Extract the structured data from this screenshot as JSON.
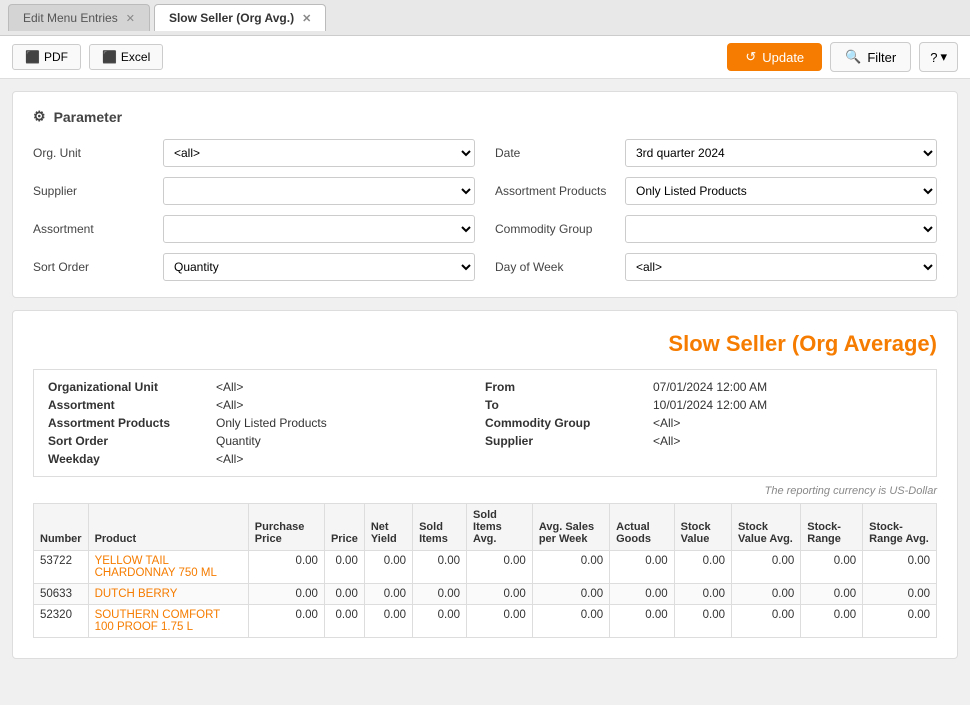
{
  "tabs": [
    {
      "label": "Edit Menu Entries",
      "active": false,
      "closable": true
    },
    {
      "label": "Slow Seller (Org Avg.)",
      "active": true,
      "closable": true
    }
  ],
  "toolbar": {
    "pdf_label": "PDF",
    "excel_label": "Excel",
    "update_label": "Update",
    "filter_label": "Filter",
    "help_label": "?"
  },
  "parameter": {
    "title": "Parameter",
    "fields": {
      "org_unit": {
        "label": "Org. Unit",
        "value": "<all>",
        "options": [
          "<all>"
        ]
      },
      "date": {
        "label": "Date",
        "value": "3rd quarter 2024",
        "options": [
          "3rd quarter 2024"
        ]
      },
      "supplier": {
        "label": "Supplier",
        "value": "",
        "options": []
      },
      "assortment_products": {
        "label": "Assortment Products",
        "value": "Only Listed Products",
        "options": [
          "Only Listed Products"
        ]
      },
      "assortment": {
        "label": "Assortment",
        "value": "",
        "options": []
      },
      "commodity_group": {
        "label": "Commodity Group",
        "value": "",
        "options": []
      },
      "sort_order": {
        "label": "Sort Order",
        "value": "Quantity",
        "options": [
          "Quantity"
        ]
      },
      "day_of_week": {
        "label": "Day of Week",
        "value": "<all>",
        "options": [
          "<all>"
        ]
      }
    }
  },
  "report": {
    "title": "Slow Seller (Org Average)",
    "meta": {
      "org_unit_label": "Organizational Unit",
      "org_unit_val": "<All>",
      "from_label": "From",
      "from_val": "07/01/2024 12:00 AM",
      "assortment_label": "Assortment",
      "assortment_val": "<All>",
      "to_label": "To",
      "to_val": "10/01/2024 12:00 AM",
      "assortment_products_label": "Assortment Products",
      "assortment_products_val": "Only Listed Products",
      "commodity_group_label": "Commodity Group",
      "commodity_group_val": "<All>",
      "sort_order_label": "Sort Order",
      "sort_order_val": "Quantity",
      "supplier_label": "Supplier",
      "supplier_val": "<All>",
      "weekday_label": "Weekday",
      "weekday_val": "<All>"
    },
    "currency_note": "The reporting currency is US-Dollar",
    "columns": [
      "Number",
      "Product",
      "Purchase Price",
      "Price",
      "Net Yield",
      "Sold Items",
      "Sold Items Avg.",
      "Avg. Sales per Week",
      "Actual Goods",
      "Stock Value",
      "Stock Value Avg.",
      "Stock-Range",
      "Stock-Range Avg."
    ],
    "rows": [
      {
        "number": "53722",
        "product": "YELLOW TAIL CHARDONNAY 750 ML",
        "purchase_price": "0.00",
        "price": "0.00",
        "net_yield": "0.00",
        "sold_items": "0.00",
        "sold_items_avg": "0.00",
        "avg_sales_per_week": "0.00",
        "actual_goods": "0.00",
        "stock_value": "0.00",
        "stock_value_avg": "0.00",
        "stock_range": "0.00",
        "stock_range_avg": "0.00"
      },
      {
        "number": "50633",
        "product": "DUTCH BERRY",
        "purchase_price": "0.00",
        "price": "0.00",
        "net_yield": "0.00",
        "sold_items": "0.00",
        "sold_items_avg": "0.00",
        "avg_sales_per_week": "0.00",
        "actual_goods": "0.00",
        "stock_value": "0.00",
        "stock_value_avg": "0.00",
        "stock_range": "0.00",
        "stock_range_avg": "0.00"
      },
      {
        "number": "52320",
        "product": "SOUTHERN COMFORT 100 PROOF 1.75 L",
        "purchase_price": "0.00",
        "price": "0.00",
        "net_yield": "0.00",
        "sold_items": "0.00",
        "sold_items_avg": "0.00",
        "avg_sales_per_week": "0.00",
        "actual_goods": "0.00",
        "stock_value": "0.00",
        "stock_value_avg": "0.00",
        "stock_range": "0.00",
        "stock_range_avg": "0.00"
      }
    ]
  }
}
